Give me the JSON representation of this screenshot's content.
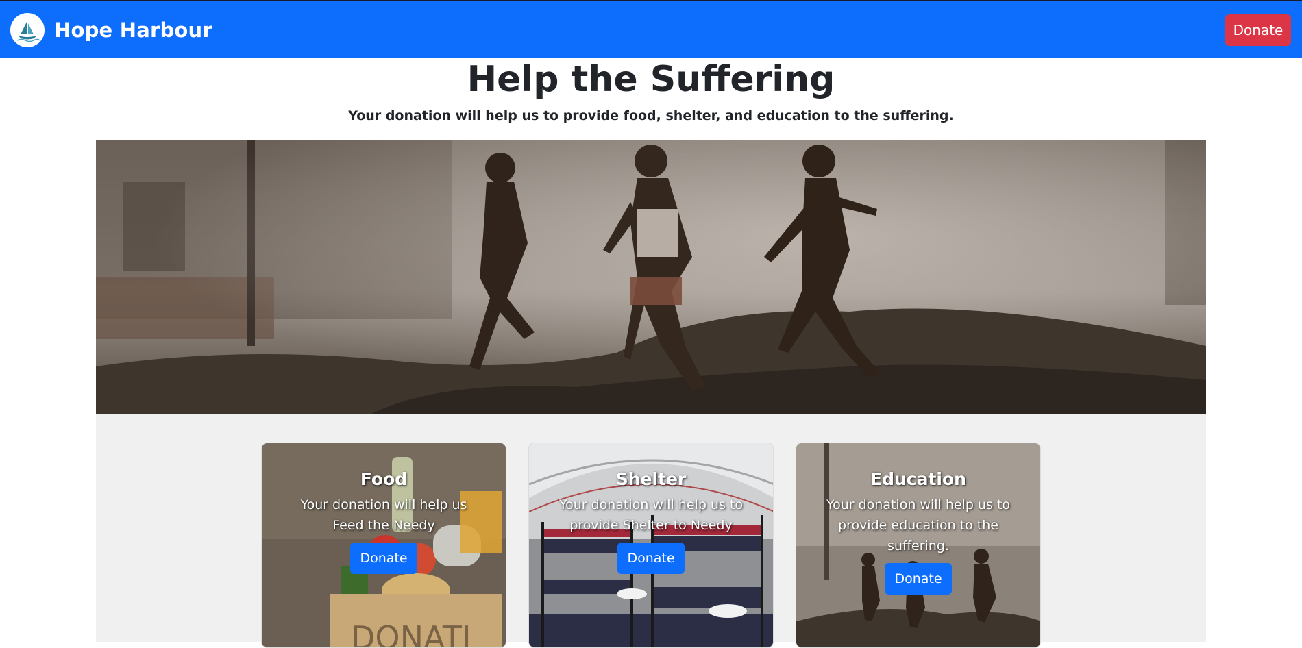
{
  "navbar": {
    "brand_name": "Hope Harbour",
    "logo_icon": "sailboat-logo-icon",
    "donate_label": "Donate",
    "color_primary": "#0d6efd",
    "color_danger": "#dc3545"
  },
  "hero": {
    "title": "Help the Suffering",
    "subtitle": "Your donation will help us to provide food, shelter, and education to the suffering."
  },
  "cards": [
    {
      "title": "Food",
      "text": "Your donation will help us Feed the Needy",
      "button_label": "Donate"
    },
    {
      "title": "Shelter",
      "text": "Your donation will help us to provide Shelter to Needy",
      "button_label": "Donate"
    },
    {
      "title": "Education",
      "text": "Your donation will help us to provide education to the suffering.",
      "button_label": "Donate"
    }
  ]
}
